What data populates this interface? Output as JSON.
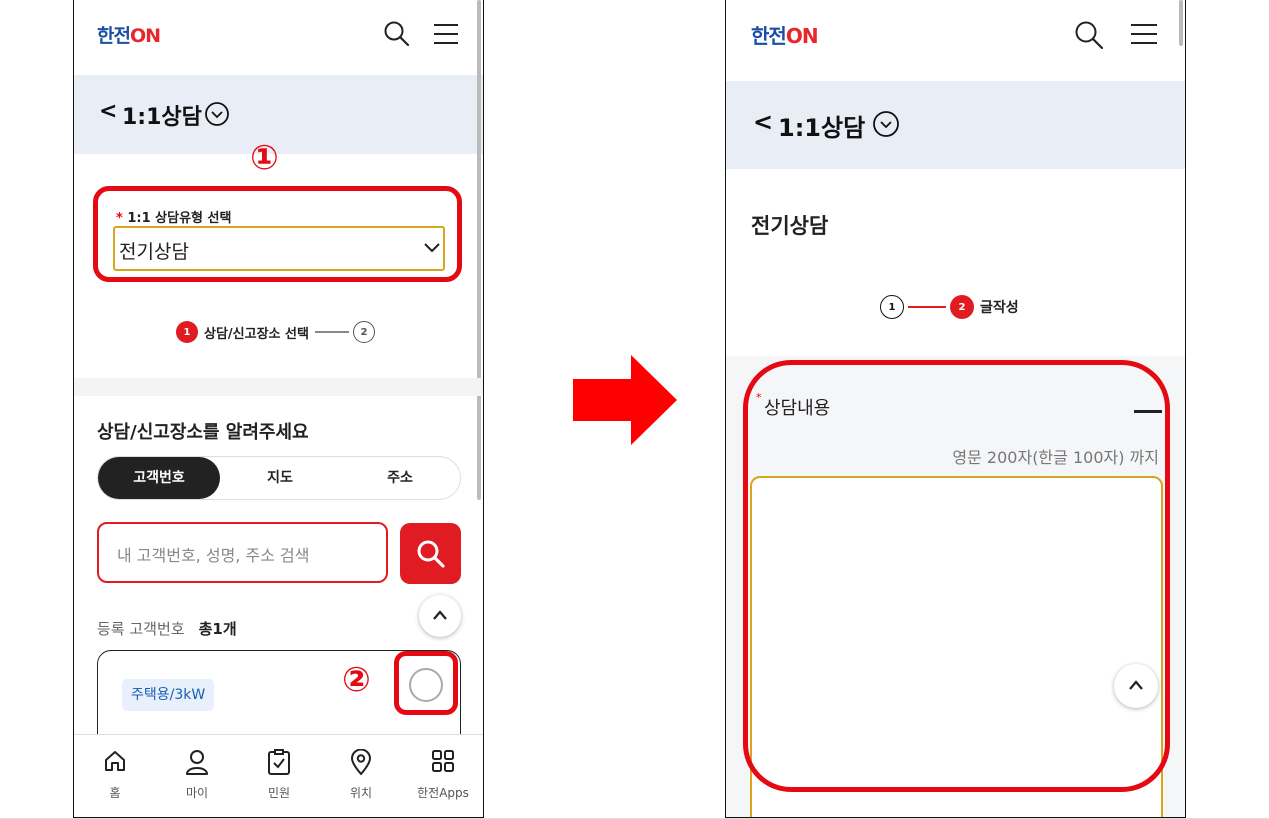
{
  "left_screen": {
    "header": {
      "logo_prefix": "한전",
      "logo_suffix": "ON"
    },
    "title_bar": {
      "back": "<",
      "title": "1:1상담"
    },
    "annotation_1": "①",
    "annotation_2": "②",
    "consult_type": {
      "required_mark": "*",
      "label": "1:1 상담유형 선택",
      "value": "전기상담"
    },
    "steps": [
      {
        "num": "1",
        "label": "상담/신고장소 선택"
      },
      {
        "num": "2"
      }
    ],
    "section_title": "상담/신고장소를 알려주세요",
    "tabs": [
      {
        "label": "고객번호"
      },
      {
        "label": "지도"
      },
      {
        "label": "주소"
      }
    ],
    "search": {
      "placeholder": "내 고객번호, 성명, 주소 검색"
    },
    "registered": {
      "label": "등록 고객번호",
      "count": "총1개"
    },
    "card": {
      "chip": "주택용/3kW"
    },
    "bottom_nav": [
      {
        "icon": "home-icon",
        "label": "홈"
      },
      {
        "icon": "person-icon",
        "label": "마이"
      },
      {
        "icon": "clipboard-check-icon",
        "label": "민원"
      },
      {
        "icon": "location-pin-icon",
        "label": "위치"
      },
      {
        "icon": "apps-grid-icon",
        "label": "한전Apps"
      }
    ]
  },
  "right_screen": {
    "header": {
      "logo_prefix": "한전",
      "logo_suffix": "ON"
    },
    "title_bar": {
      "back": "<",
      "title": "1:1상담"
    },
    "section_title": "전기상담",
    "steps": [
      {
        "num": "1"
      },
      {
        "num": "2",
        "label": "글작성"
      }
    ],
    "content": {
      "required_mark": "*",
      "label": "상담내용",
      "limit_hint": "영문 200자(한글 100자) 까지"
    }
  },
  "colors": {
    "brand_red": "#e01b22",
    "annotation_red": "#e50914",
    "title_bar_bg": "#e8edf6",
    "focus_border": "#d9a520"
  }
}
